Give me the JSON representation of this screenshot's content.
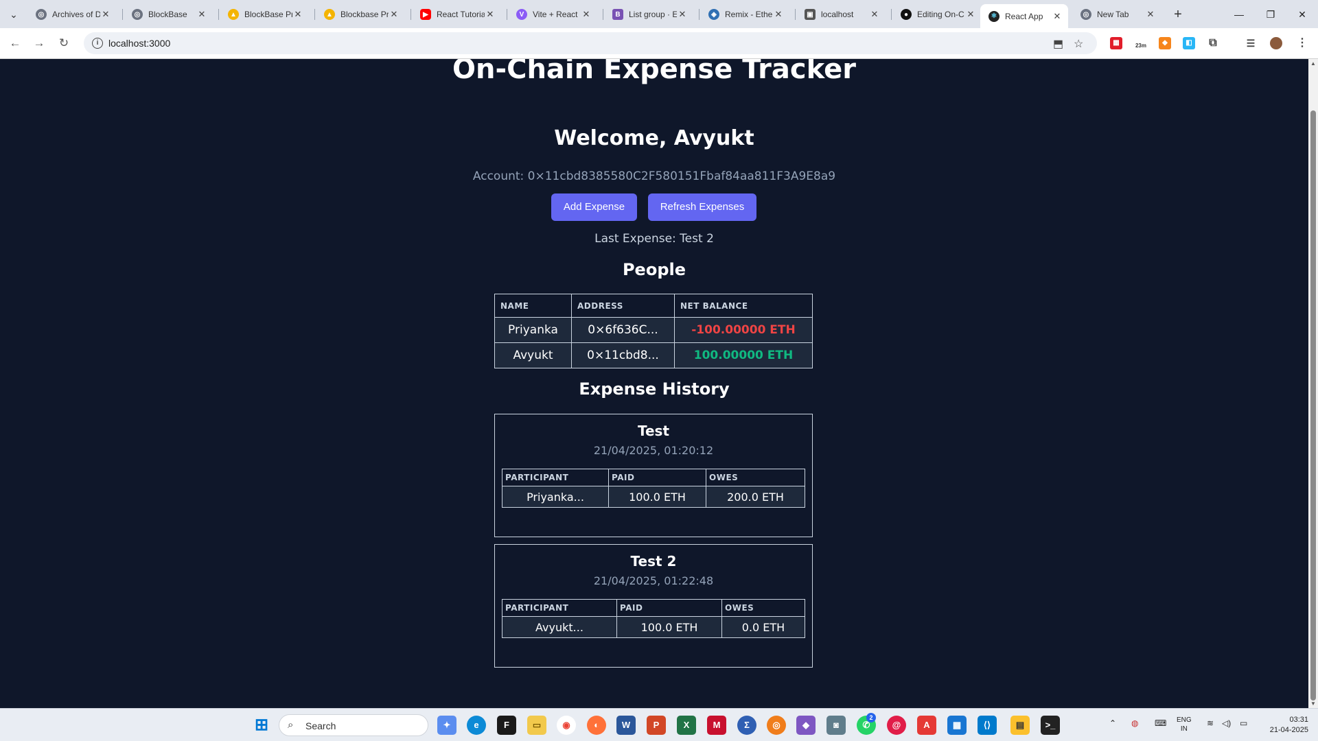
{
  "tabs": [
    {
      "label": "Archives of D",
      "icon": "globe-icon"
    },
    {
      "label": "BlockBase",
      "icon": "globe-icon"
    },
    {
      "label": "BlockBase Pr",
      "icon": "google-drive-icon"
    },
    {
      "label": "Blockbase Pr",
      "icon": "google-drive-icon"
    },
    {
      "label": "React Tutoria",
      "icon": "youtube-icon"
    },
    {
      "label": "Vite + React",
      "icon": "vite-icon"
    },
    {
      "label": "List group · E",
      "icon": "bootstrap-icon"
    },
    {
      "label": "Remix - Ethe",
      "icon": "remix-icon"
    },
    {
      "label": "localhost",
      "icon": "localhost-icon"
    },
    {
      "label": "Editing On-C",
      "icon": "github-icon"
    },
    {
      "label": "React App",
      "icon": "react-icon"
    },
    {
      "label": "New Tab",
      "icon": "globe-icon"
    }
  ],
  "address": {
    "url": "localhost:3000"
  },
  "extensions": {
    "badge": "23m"
  },
  "app": {
    "title": "On-Chain Expense Tracker",
    "welcome": "Welcome, Avyukt",
    "account": "Account: 0×11cbd8385580C2F580151Fbaf84aa811F3A9E8a9",
    "add_label": "Add Expense",
    "refresh_label": "Refresh Expenses",
    "last_expense": "Last Expense: Test 2",
    "people_title": "People",
    "people_headers": [
      "NAME",
      "ADDRESS",
      "NET BALANCE"
    ],
    "people": [
      {
        "name": "Priyanka",
        "address": "0×6f636C...",
        "balance": "-100.00000 ETH",
        "status": "negative"
      },
      {
        "name": "Avyukt",
        "address": "0×11cbd8...",
        "balance": "100.00000 ETH",
        "status": "positive"
      }
    ],
    "history_title": "Expense History",
    "participant_headers": [
      "PARTICIPANT",
      "PAID",
      "OWES"
    ],
    "expenses": [
      {
        "title": "Test",
        "date": "21/04/2025, 01:20:12",
        "rows": [
          {
            "participant": "Priyanka...",
            "paid": "100.0 ETH",
            "owes": "200.0 ETH"
          }
        ]
      },
      {
        "title": "Test 2",
        "date": "21/04/2025, 01:22:48",
        "rows": [
          {
            "participant": "Avyukt...",
            "paid": "100.0 ETH",
            "owes": "0.0 ETH"
          }
        ]
      }
    ]
  },
  "taskbar": {
    "search_placeholder": "Search",
    "whatsapp_badge": "2",
    "lang_line1": "ENG",
    "lang_line2": "IN",
    "time": "03:31",
    "date": "21-04-2025"
  },
  "colors": {
    "page_bg": "#0f172a",
    "button": "#6366f1",
    "negative": "#ef4444",
    "positive": "#10b981"
  }
}
